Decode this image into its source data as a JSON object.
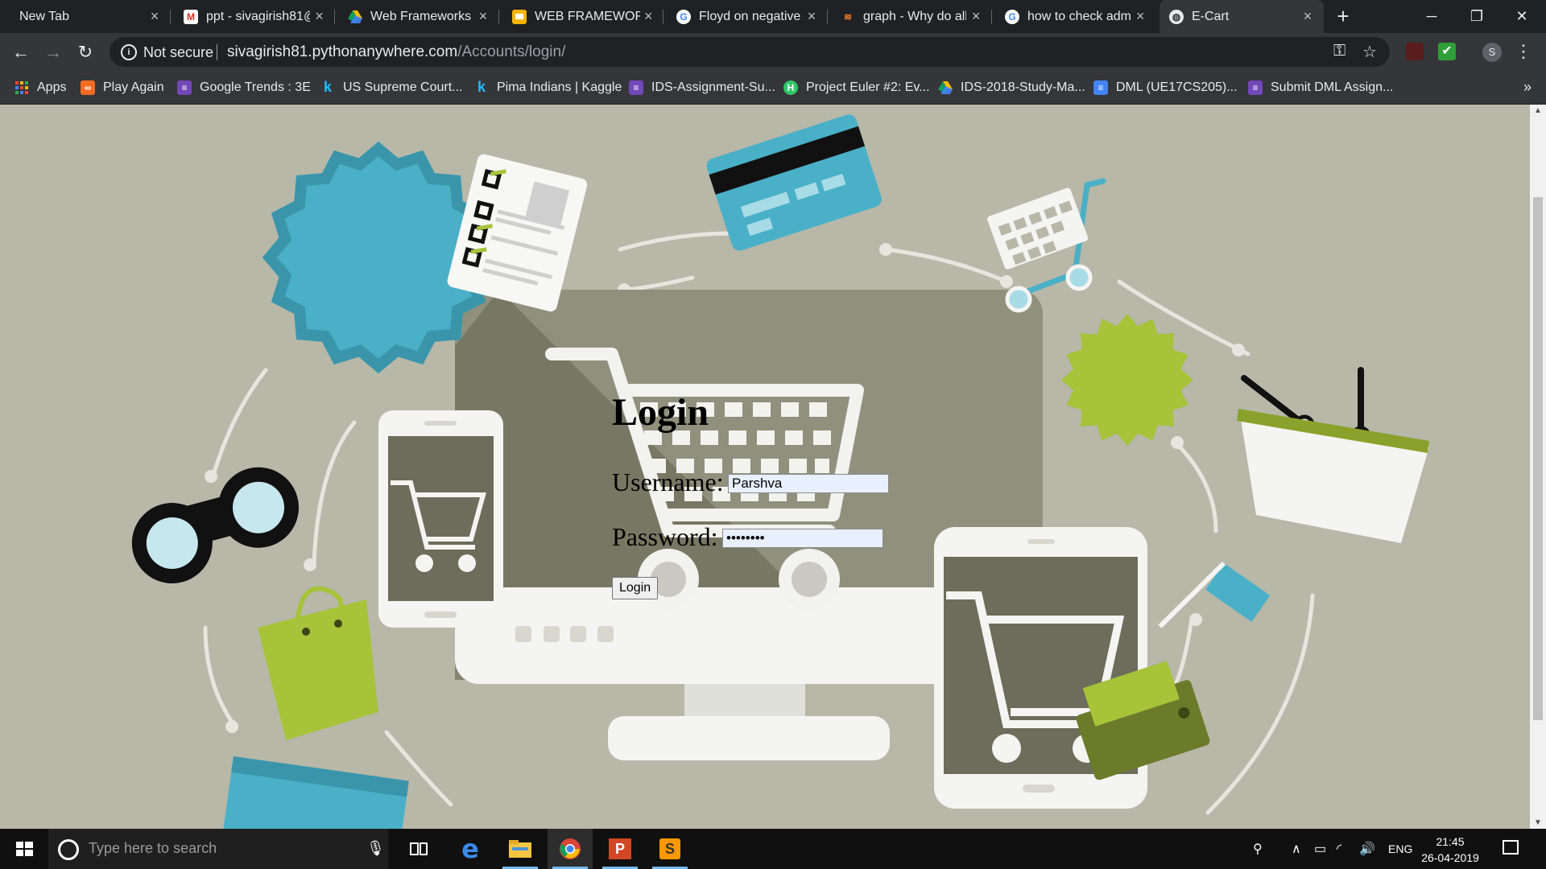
{
  "tabs": [
    {
      "title": "New Tab",
      "icon": "none"
    },
    {
      "title": "ppt - sivagirish81@",
      "icon": "gmail-icon"
    },
    {
      "title": "Web Frameworks",
      "icon": "drive-icon"
    },
    {
      "title": "WEB FRAMEWORK",
      "icon": "slides-icon"
    },
    {
      "title": "Floyd on negative",
      "icon": "google-icon"
    },
    {
      "title": "graph - Why do all",
      "icon": "stackoverflow-icon"
    },
    {
      "title": "how to check adm",
      "icon": "google-icon"
    },
    {
      "title": "E-Cart",
      "icon": "globe-icon",
      "active": true
    }
  ],
  "toolbar": {
    "security_label": "Not secure",
    "url_host": "sivagirish81.pythonanywhere.com",
    "url_path": "/Accounts/login/",
    "profile_initial": "S"
  },
  "bookmarks": [
    {
      "label": "Apps",
      "icon": "apps-grid-icon"
    },
    {
      "label": "Play Again",
      "icon": "play-again-icon"
    },
    {
      "label": "Google Trends : 3E",
      "icon": "forms-icon"
    },
    {
      "label": "US Supreme Court...",
      "icon": "kaggle-icon"
    },
    {
      "label": "Pima Indians | Kaggle",
      "icon": "kaggle-icon"
    },
    {
      "label": "IDS-Assignment-Su...",
      "icon": "forms-icon"
    },
    {
      "label": "Project Euler #2: Ev...",
      "icon": "hackerrank-icon"
    },
    {
      "label": "IDS-2018-Study-Ma...",
      "icon": "drive-icon"
    },
    {
      "label": "DML (UE17CS205)...",
      "icon": "docs-icon"
    },
    {
      "label": "Submit DML Assign...",
      "icon": "forms-icon"
    }
  ],
  "login": {
    "title": "Login",
    "username_label": "Username:",
    "username_value": "Parshva",
    "password_label": "Password:",
    "password_value": "••••••••",
    "button_label": "Login"
  },
  "taskbar": {
    "search_placeholder": "Type here to search",
    "language": "ENG",
    "time": "21:45",
    "date": "26-04-2019"
  },
  "colors": {
    "page_bg": "#b7b8a8",
    "monitor": "#8f917d",
    "accent_blue": "#4ab0c8",
    "accent_green": "#a6c33a"
  }
}
